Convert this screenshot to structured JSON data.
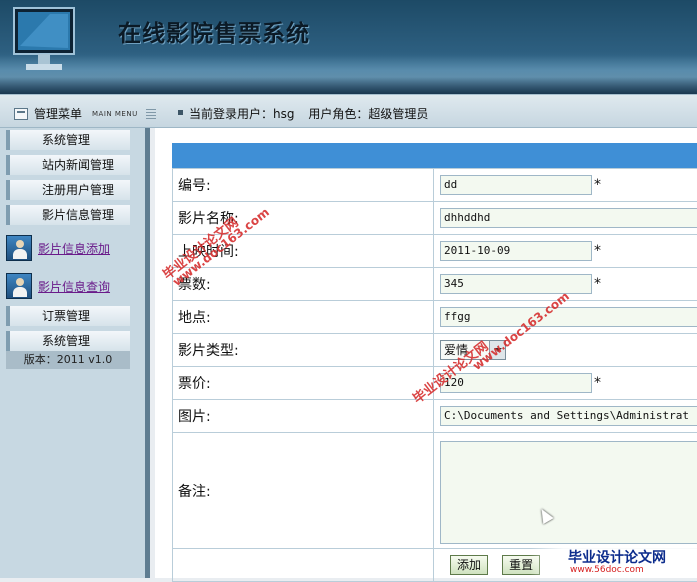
{
  "app": {
    "title": "在线影院售票系统"
  },
  "nav": {
    "menu_label": "管理菜单",
    "menu_sub": "MAIN MENU",
    "user_label": "当前登录用户：hsg",
    "role_label": "用户角色：超级管理员"
  },
  "sidebar": {
    "items": [
      {
        "label": "系统管理"
      },
      {
        "label": "站内新闻管理"
      },
      {
        "label": "注册用户管理"
      },
      {
        "label": "影片信息管理"
      }
    ],
    "links": [
      {
        "label": "影片信息添加",
        "icon": "person-icon"
      },
      {
        "label": "影片信息查询",
        "icon": "person-icon"
      }
    ],
    "items2": [
      {
        "label": "订票管理"
      },
      {
        "label": "系统管理"
      }
    ],
    "version": "版本：2011 v1.0"
  },
  "form": {
    "id": {
      "label": "编号:",
      "value": "dd"
    },
    "name": {
      "label": "影片名称:",
      "value": "dhhddhd"
    },
    "time": {
      "label": "上映时间:",
      "value": "2011-10-09"
    },
    "tickets": {
      "label": "票数:",
      "value": "345"
    },
    "place": {
      "label": "地点:",
      "value": "ffgg"
    },
    "type": {
      "label": "影片类型:",
      "value": "爱情"
    },
    "price": {
      "label": "票价:",
      "value": "120"
    },
    "image": {
      "label": "图片:",
      "value": "C:\\Documents and Settings\\Administrat"
    },
    "remark": {
      "label": "备注:",
      "value": ""
    },
    "required_mark": "*",
    "buttons": {
      "add": "添加",
      "reset": "重置"
    }
  },
  "watermarks": {
    "site_cn": "毕业设计论文网",
    "site_url": "www.doc163.com",
    "logo_cn": "毕业设计论文网",
    "logo_url": "www.56doc.com"
  },
  "colors": {
    "header_dark": "#1d4a66",
    "form_header": "#3f8fd6",
    "sidebar_bg": "#c7d8e2",
    "watermark": "#d63030"
  }
}
